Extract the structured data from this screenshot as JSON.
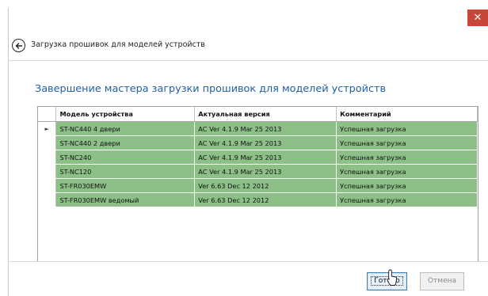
{
  "window": {
    "close_label": "✕"
  },
  "header": {
    "title": "Загрузка прошивок для моделей устройств"
  },
  "main": {
    "subtitle": "Завершение мастера загрузки прошивок для моделей устройств"
  },
  "table": {
    "columns": [
      "Модель устройства",
      "Актуальная версия",
      "Комментарий"
    ],
    "current_row_marker": "►",
    "rows": [
      {
        "model": "ST-NC440 4 двери",
        "version": "AC Ver 4.1.9 Mar 25 2013",
        "comment": "Успешная загрузка"
      },
      {
        "model": "ST-NC440 2 двери",
        "version": "AC Ver 4.1.9 Mar 25 2013",
        "comment": "Успешная загрузка"
      },
      {
        "model": "ST-NC240",
        "version": "AC Ver 4.1.9 Mar 25 2013",
        "comment": "Успешная загрузка"
      },
      {
        "model": "ST-NC120",
        "version": "AC Ver 4.1.9 Mar 25 2013",
        "comment": "Успешная загрузка"
      },
      {
        "model": "ST-FR030EMW",
        "version": "Ver 6.63 Dec 12 2012",
        "comment": "Успешная загрузка"
      },
      {
        "model": "ST-FR030EMW ведомый",
        "version": "Ver 6.63 Dec 12 2012",
        "comment": "Успешная загрузка"
      }
    ],
    "success_row_color": "#8cc087"
  },
  "footer": {
    "ok_label": "Готово",
    "cancel_label": "Отмена"
  },
  "colors": {
    "accent": "#1f5fa6",
    "close": "#c7463a"
  }
}
